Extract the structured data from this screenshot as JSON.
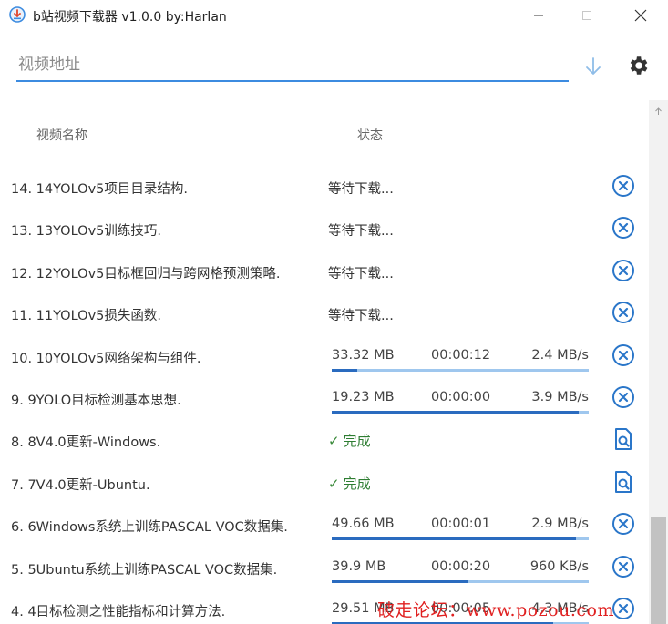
{
  "window": {
    "title": "b站视频下载器 v1.0.0 by:Harlan"
  },
  "url_input": {
    "placeholder": "视频地址",
    "value": ""
  },
  "header": {
    "name_label": "视频名称",
    "status_label": "状态"
  },
  "colors": {
    "accent": "#3c8be0",
    "progress_track": "#9fc7ee",
    "progress_fill": "#2a6bbf",
    "done": "#2e7d32",
    "watermark": "#e02020"
  },
  "items": [
    {
      "name": "14. 14YOLOv5项目目录结构.",
      "state": "waiting",
      "status": "等待下载...",
      "action_icon": "cancel-icon"
    },
    {
      "name": "13. 13YOLOv5训练技巧.",
      "state": "waiting",
      "status": "等待下载...",
      "action_icon": "cancel-icon"
    },
    {
      "name": "12. 12YOLOv5目标框回归与跨网格预测策略.",
      "state": "waiting",
      "status": "等待下载...",
      "action_icon": "cancel-icon"
    },
    {
      "name": "11. 11YOLOv5损失函数.",
      "state": "waiting",
      "status": "等待下载...",
      "action_icon": "cancel-icon"
    },
    {
      "name": "10. 10YOLOv5网络架构与组件.",
      "state": "downloading",
      "size": "33.32 MB",
      "time": "00:00:12",
      "speed": "2.4 MB/s",
      "progress": 0.1,
      "action_icon": "cancel-icon"
    },
    {
      "name": "9. 9YOLO目标检测基本思想.",
      "state": "downloading",
      "size": "19.23 MB",
      "time": "00:00:00",
      "speed": "3.9 MB/s",
      "progress": 0.96,
      "action_icon": "cancel-icon"
    },
    {
      "name": "8. 8V4.0更新-Windows.",
      "state": "done",
      "status": "完成",
      "check": "✓",
      "action_icon": "open-file-icon"
    },
    {
      "name": "7. 7V4.0更新-Ubuntu.",
      "state": "done",
      "status": "完成",
      "check": "✓",
      "action_icon": "open-file-icon"
    },
    {
      "name": "6. 6Windows系统上训练PASCAL VOC数据集.",
      "state": "downloading",
      "size": "49.66 MB",
      "time": "00:00:01",
      "speed": "2.9 MB/s",
      "progress": 0.95,
      "action_icon": "cancel-icon"
    },
    {
      "name": "5. 5Ubuntu系统上训练PASCAL VOC数据集.",
      "state": "downloading",
      "size": "39.9 MB",
      "time": "00:00:20",
      "speed": "960 KB/s",
      "progress": 0.53,
      "action_icon": "cancel-icon"
    },
    {
      "name": "4. 4目标检测之性能指标和计算方法.",
      "state": "downloading",
      "size": "29.51 MB",
      "time": "00:00:05",
      "speed": "4.3 MB/s",
      "progress": 0.86,
      "action_icon": "cancel-icon"
    }
  ],
  "watermark": {
    "text": "破走论坛：www.pozou.com"
  }
}
